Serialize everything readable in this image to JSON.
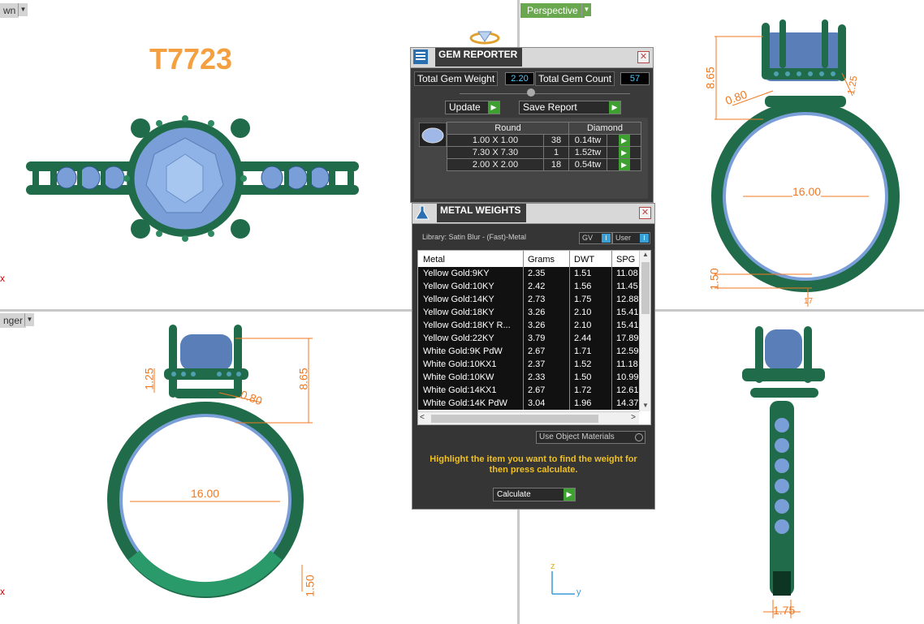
{
  "viewports": {
    "top_left": {
      "tab_label": "wn",
      "title": "T7723"
    },
    "top_right": {
      "tab_label": "Perspective",
      "dims": [
        "8.65",
        "0.80",
        "1.25",
        "16.00",
        "1.50",
        "17"
      ]
    },
    "bottom_left": {
      "tab_label": "nger",
      "dims": [
        "1.25",
        "8.65",
        "0.80",
        "16.00",
        "1.50"
      ],
      "axis_mark": "x"
    },
    "bottom_right": {
      "dims": [
        "1.75"
      ],
      "axis_z": "z",
      "axis_y": "y"
    },
    "top_left_axis_mark": "x"
  },
  "gem_reporter": {
    "title": "GEM REPORTER",
    "total_weight_label": "Total Gem Weight",
    "total_weight_value": "2.20",
    "total_count_label": "Total Gem Count",
    "total_count_value": "57",
    "update_label": "Update",
    "save_label": "Save Report",
    "table_headers": [
      "Round",
      "Diamond"
    ],
    "rows": [
      {
        "size": "1.00 X 1.00",
        "count": "38",
        "weight": "0.14tw"
      },
      {
        "size": "7.30 X 7.30",
        "count": "1",
        "weight": "1.52tw"
      },
      {
        "size": "2.00 X 2.00",
        "count": "18",
        "weight": "0.54tw"
      }
    ]
  },
  "metal_weights": {
    "title": "METAL WEIGHTS",
    "library": "Library: Satin Blur - (Fast)-Metal",
    "gv_label": "GV",
    "user_label": "User",
    "columns": [
      "Metal",
      "Grams",
      "DWT",
      "SPG"
    ],
    "rows": [
      {
        "metal": "Yellow Gold:9KY",
        "grams": "2.35",
        "dwt": "1.51",
        "spg": "11.08"
      },
      {
        "metal": "Yellow Gold:10KY",
        "grams": "2.42",
        "dwt": "1.56",
        "spg": "11.45"
      },
      {
        "metal": "Yellow Gold:14KY",
        "grams": "2.73",
        "dwt": "1.75",
        "spg": "12.88"
      },
      {
        "metal": "Yellow Gold:18KY",
        "grams": "3.26",
        "dwt": "2.10",
        "spg": "15.41"
      },
      {
        "metal": "Yellow Gold:18KY R...",
        "grams": "3.26",
        "dwt": "2.10",
        "spg": "15.41"
      },
      {
        "metal": "Yellow Gold:22KY",
        "grams": "3.79",
        "dwt": "2.44",
        "spg": "17.89"
      },
      {
        "metal": "White Gold:9K PdW",
        "grams": "2.67",
        "dwt": "1.71",
        "spg": "12.59"
      },
      {
        "metal": "White Gold:10KX1",
        "grams": "2.37",
        "dwt": "1.52",
        "spg": "11.18"
      },
      {
        "metal": "White Gold:10KW",
        "grams": "2.33",
        "dwt": "1.50",
        "spg": "10.99"
      },
      {
        "metal": "White Gold:14KX1",
        "grams": "2.67",
        "dwt": "1.72",
        "spg": "12.61"
      },
      {
        "metal": "White Gold:14K PdW",
        "grams": "3.04",
        "dwt": "1.96",
        "spg": "14.37"
      }
    ],
    "use_object_materials": "Use Object Materials",
    "instruction": "Highlight the item you want to find the weight for then press calculate.",
    "calculate_label": "Calculate"
  },
  "colors": {
    "ring_green": "#1f6b4a",
    "gem_blue": "#7a9fd8",
    "dim_orange": "#f07820",
    "title_orange": "#f4a040",
    "panel_bg": "#3a3a3a",
    "accent_green": "#3da030",
    "instruction_yellow": "#f0c020"
  }
}
